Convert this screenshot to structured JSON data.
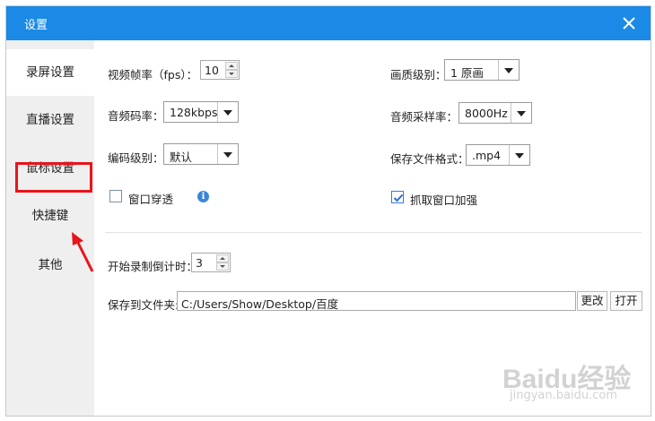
{
  "window": {
    "title": "设置"
  },
  "sidebar": {
    "items": [
      {
        "label": "录屏设置",
        "active": true
      },
      {
        "label": "直播设置",
        "active": false
      },
      {
        "label": "鼠标设置",
        "active": false
      },
      {
        "label": "快捷键",
        "active": false,
        "highlighted": true
      },
      {
        "label": "其他",
        "active": false
      }
    ],
    "annotation_color": "#e8141a"
  },
  "settings": {
    "fps_label": "视频帧率（fps）：",
    "fps_value": "10",
    "quality_label": "画质级别：",
    "quality_value": "1 原画",
    "audio_bitrate_label": "音频码率：",
    "audio_bitrate_value": "128kbps",
    "sample_rate_label": "音频采样率：",
    "sample_rate_value": "8000Hz",
    "encode_level_label": "编码级别：",
    "encode_level_value": "默认",
    "file_format_label": "保存文件格式：",
    "file_format_value": ".mp4",
    "window_through_label": "窗口穿透",
    "window_through_checked": false,
    "capture_enhance_label": "抓取窗口加强",
    "capture_enhance_checked": true,
    "countdown_label": "开始录制倒计时：",
    "countdown_value": "3",
    "save_to_label": "保存到文件夹:",
    "save_path": "C:/Users/Show/Desktop/百度",
    "change_button": "更改",
    "open_button": "打开"
  },
  "watermark": {
    "logo": "Baidu经验",
    "url": "jingyan.baidu.com"
  },
  "colors": {
    "titlebar": "#1a8ae6",
    "sidebar": "#efefef"
  }
}
